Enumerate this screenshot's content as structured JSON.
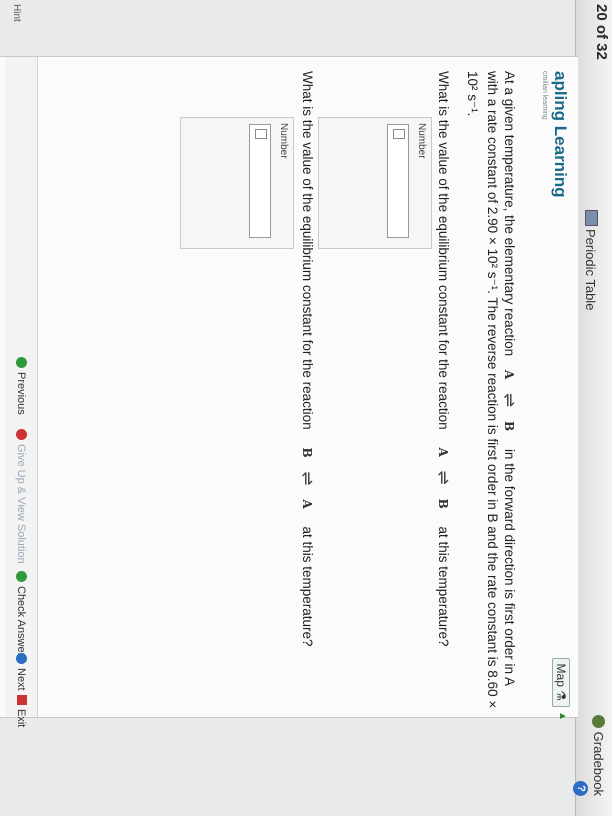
{
  "header": {
    "question_counter": "20 of 32",
    "periodic_table_label": "Periodic Table",
    "gradebook_label": "Gradebook"
  },
  "brand": {
    "name": "apling Learning",
    "tagline": "cmillan learning"
  },
  "map_button": "Map",
  "question": {
    "line1_prefix": "At a given temperature, the elementary reaction",
    "line1_species_left": "A",
    "line1_species_right": "B",
    "line1_suffix": "in the forward direction is first order in A",
    "line2": "with a rate constant of 2.90 × 10² s⁻¹. The reverse reaction is first order in B and the rate constant is 8.60 ×",
    "line3": "10² s⁻¹.",
    "part1_prefix": "What is the value of the equilibrium constant for the reaction",
    "part1_left": "A",
    "part1_right": "B",
    "part1_suffix": "at this temperature?",
    "part2_prefix": "What is the value of the equilibrium constant for the reaction",
    "part2_left": "B",
    "part2_right": "A",
    "part2_suffix": "at this temperature?"
  },
  "answers": {
    "label1": "Number",
    "value1": "",
    "label2": "Number",
    "value2": ""
  },
  "footer": {
    "previous": "Previous",
    "give_up": "Give Up & View Solution",
    "check": "Check Answer",
    "next": "Next",
    "exit": "Exit",
    "hint": "Hint"
  }
}
